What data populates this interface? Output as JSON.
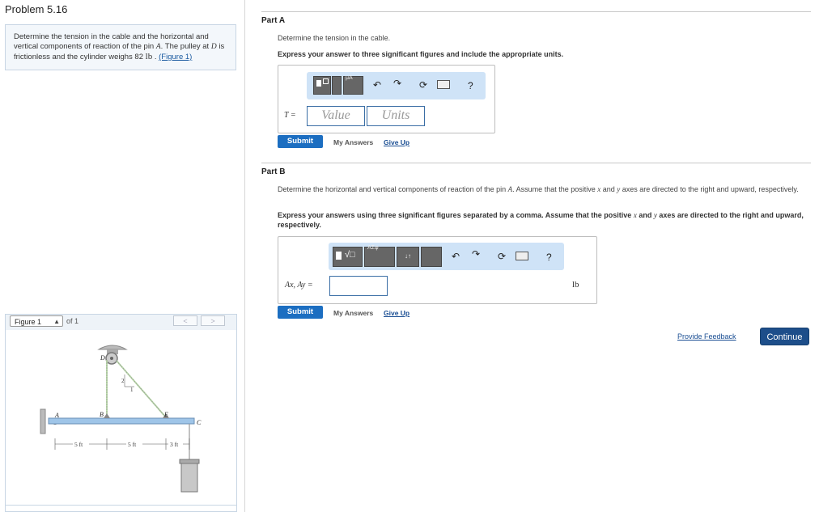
{
  "problem": {
    "title": "Problem 5.16",
    "text_before_A": "Determine the tension in the cable and the horizontal and vertical components of reaction of the pin ",
    "pin_symbol": "A",
    "text_after_A": ". The pulley at ",
    "pulley_symbol": "D",
    "text_after_D": " is frictionless and the cylinder weighs 82 ",
    "weight_unit": "lb",
    "text_before_link": " . ",
    "figure_link": "(Figure 1)"
  },
  "figure": {
    "selector_value": "Figure 1",
    "of_label": "of 1",
    "prev_label": "<",
    "next_label": ">",
    "labels": {
      "A": "A",
      "B": "B",
      "C": "C",
      "D": "D",
      "E": "E",
      "slope_2": "2",
      "slope_1": "1"
    },
    "dims": [
      "5 ft",
      "5 ft",
      "3 ft"
    ]
  },
  "part_a": {
    "title": "Part A",
    "question": "Determine the tension in the cable.",
    "instruction": "Express your answer to three significant figures and include the appropriate units.",
    "var_label": "T =",
    "value_placeholder": "Value",
    "units_placeholder": "Units",
    "toolbar_icons": [
      "templates-icon",
      "undo-icon",
      "redo-icon",
      "reset-icon",
      "keyboard-icon",
      "help-icon"
    ],
    "help_label": "?",
    "submit_label": "Submit",
    "my_answers_label": "My Answers",
    "give_up_label": "Give Up"
  },
  "part_b": {
    "title": "Part B",
    "question_1": "Determine the horizontal and vertical components of reaction of the pin ",
    "question_A": "A",
    "question_2": ". Assume that the positive ",
    "question_x": "x",
    "question_3": " and ",
    "question_y": "y",
    "question_4": " axes are directed to the right and upward, respectively.",
    "instruction_1": "Express your answers using three significant figures separated by a comma. Assume that the positive ",
    "instruction_x": "x",
    "instruction_2": " and ",
    "instruction_y": "y",
    "instruction_3": " axes are directed to the right and upward, respectively.",
    "var_label": "Ax, Ay =",
    "unit_label": "lb",
    "help_label": "?",
    "submit_label": "Submit",
    "my_answers_label": "My Answers",
    "give_up_label": "Give Up"
  },
  "footer": {
    "feedback_label": "Provide Feedback",
    "continue_label": "Continue"
  },
  "colors": {
    "accent_blue": "#1c6ec1",
    "toolbar_blue": "#cfe3f7",
    "continue_blue": "#1d4e8a",
    "beam_blue": "#9fc5e8"
  }
}
